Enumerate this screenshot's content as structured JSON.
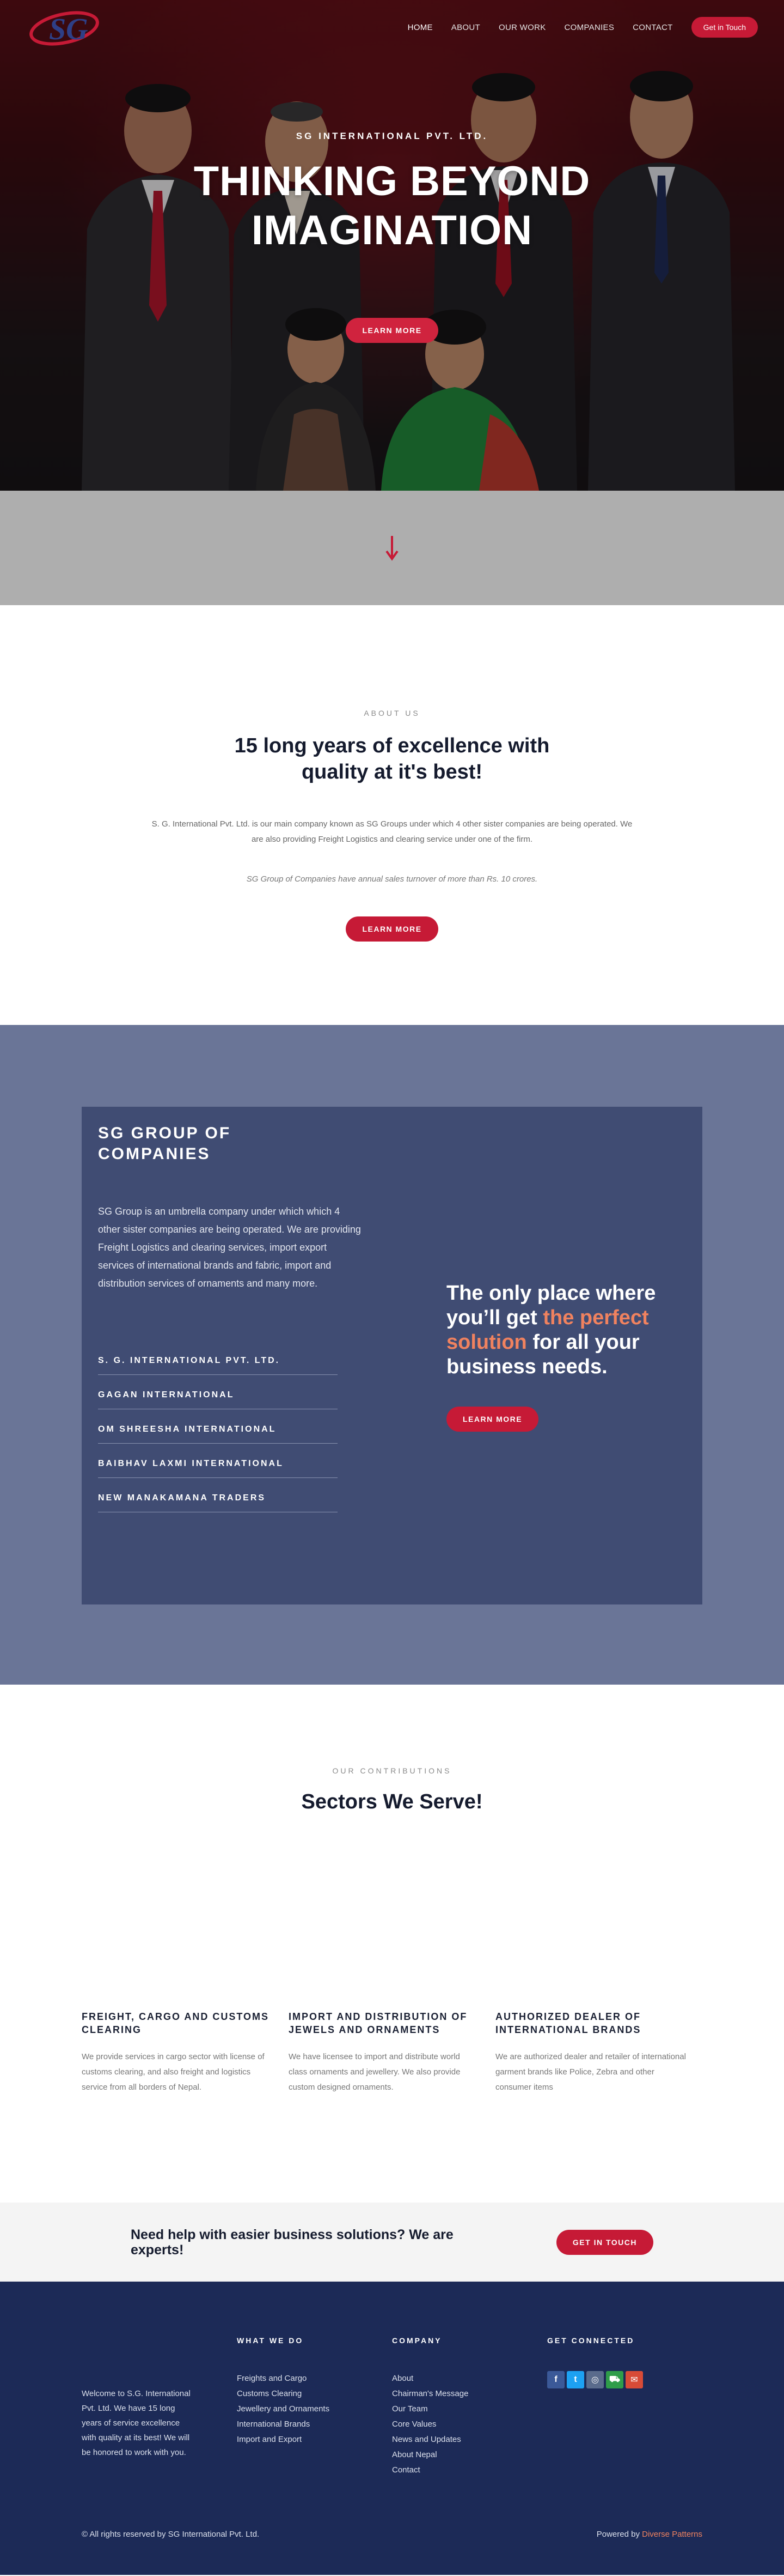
{
  "nav": {
    "logo_text": "SG",
    "links": [
      "HOME",
      "ABOUT",
      "OUR WORK",
      "COMPANIES",
      "CONTACT"
    ],
    "cta": "Get in Touch"
  },
  "hero": {
    "subtitle": "SG INTERNATIONAL PVT. LTD.",
    "title_line1": "THINKING BEYOND",
    "title_line2": "IMAGINATION",
    "button": "LEARN MORE"
  },
  "about": {
    "eyebrow": "ABOUT US",
    "heading": "15 long years of excellence with quality at it's best!",
    "lead": "S. G. International Pvt. Ltd. is our main company known as SG Groups under which 4 other sister companies are being operated. We are also providing Freight Logistics and clearing service under one of the firm.",
    "note": "SG Group of Companies have annual sales turnover of more than Rs. 10 crores.",
    "button": "LEARN MORE"
  },
  "group": {
    "heading_line1": "SG GROUP OF",
    "heading_line2": "COMPANIES",
    "description": "SG Group is an umbrella company under which which 4 other sister companies are being operated. We are providing Freight Logistics and clearing services,  import export services of international brands and fabric, import and distribution services of ornaments and many more.",
    "companies": [
      "S. G. INTERNATIONAL PVT. LTD.",
      "GAGAN INTERNATIONAL",
      "OM SHREESHA INTERNATIONAL",
      "BAIBHAV LAXMI INTERNATIONAL",
      "NEW MANAKAMANA TRADERS"
    ],
    "tagline_pre": "The only place where you’ll get ",
    "tagline_highlight": "the perfect solution",
    "tagline_post": " for all your business needs.",
    "button": "LEARN MORE"
  },
  "sectors": {
    "eyebrow": "OUR CONTRIBUTIONS",
    "heading": "Sectors We Serve!",
    "items": [
      {
        "title": "FREIGHT, CARGO AND CUSTOMS CLEARING",
        "text": "We provide services in cargo sector with license of customs clearing, and also freight and logistics service from all borders of Nepal."
      },
      {
        "title": "IMPORT AND DISTRIBUTION OF JEWELS AND ORNAMENTS",
        "text": "We have licensee to import and distribute world class ornaments and jewellery. We also provide custom designed ornaments."
      },
      {
        "title": "AUTHORIZED DEALER OF INTERNATIONAL BRANDS",
        "text": "We are authorized dealer and retailer of international garment brands like Police, Zebra and other consumer items"
      }
    ]
  },
  "cta": {
    "text": "Need help with easier business solutions? We are experts!",
    "button": "GET IN TOUCH"
  },
  "footer": {
    "about": "Welcome to S.G. International Pvt. Ltd. We have 15 long years of service excellence with quality at its best!  We will be honored to work with you.",
    "col1_title": "WHAT WE DO",
    "col1_items": [
      "Freights and Cargo",
      "Customs Clearing",
      "Jewellery and Ornaments",
      "International Brands",
      "Import and Export"
    ],
    "col2_title": "COMPANY",
    "col2_items": [
      "About",
      "Chairman's Message",
      "Our Team",
      "Core Values",
      "News and Updates",
      "About Nepal",
      "Contact"
    ],
    "col3_title": "GET CONNECTED",
    "social": [
      {
        "icon": "facebook-icon",
        "glyph": "f",
        "color": "#3b5998"
      },
      {
        "icon": "twitter-icon",
        "glyph": "t",
        "color": "#1da1f2"
      },
      {
        "icon": "instagram-icon",
        "glyph": "◎",
        "color": "#5a6b8c"
      },
      {
        "icon": "shop-icon",
        "glyph": "⛟",
        "color": "#2f9d4a"
      },
      {
        "icon": "email-icon",
        "glyph": "✉",
        "color": "#d84b37"
      }
    ],
    "copyright": "© All rights reserved by SG International Pvt. Ltd.",
    "powered_pre": "Powered by ",
    "powered_link": "Diverse Patterns"
  },
  "colors": {
    "accent": "#c61a36",
    "navy": "#1c2a57",
    "group_bg": "#6a7597",
    "group_box": "#404c73",
    "highlight": "#f0825f"
  }
}
